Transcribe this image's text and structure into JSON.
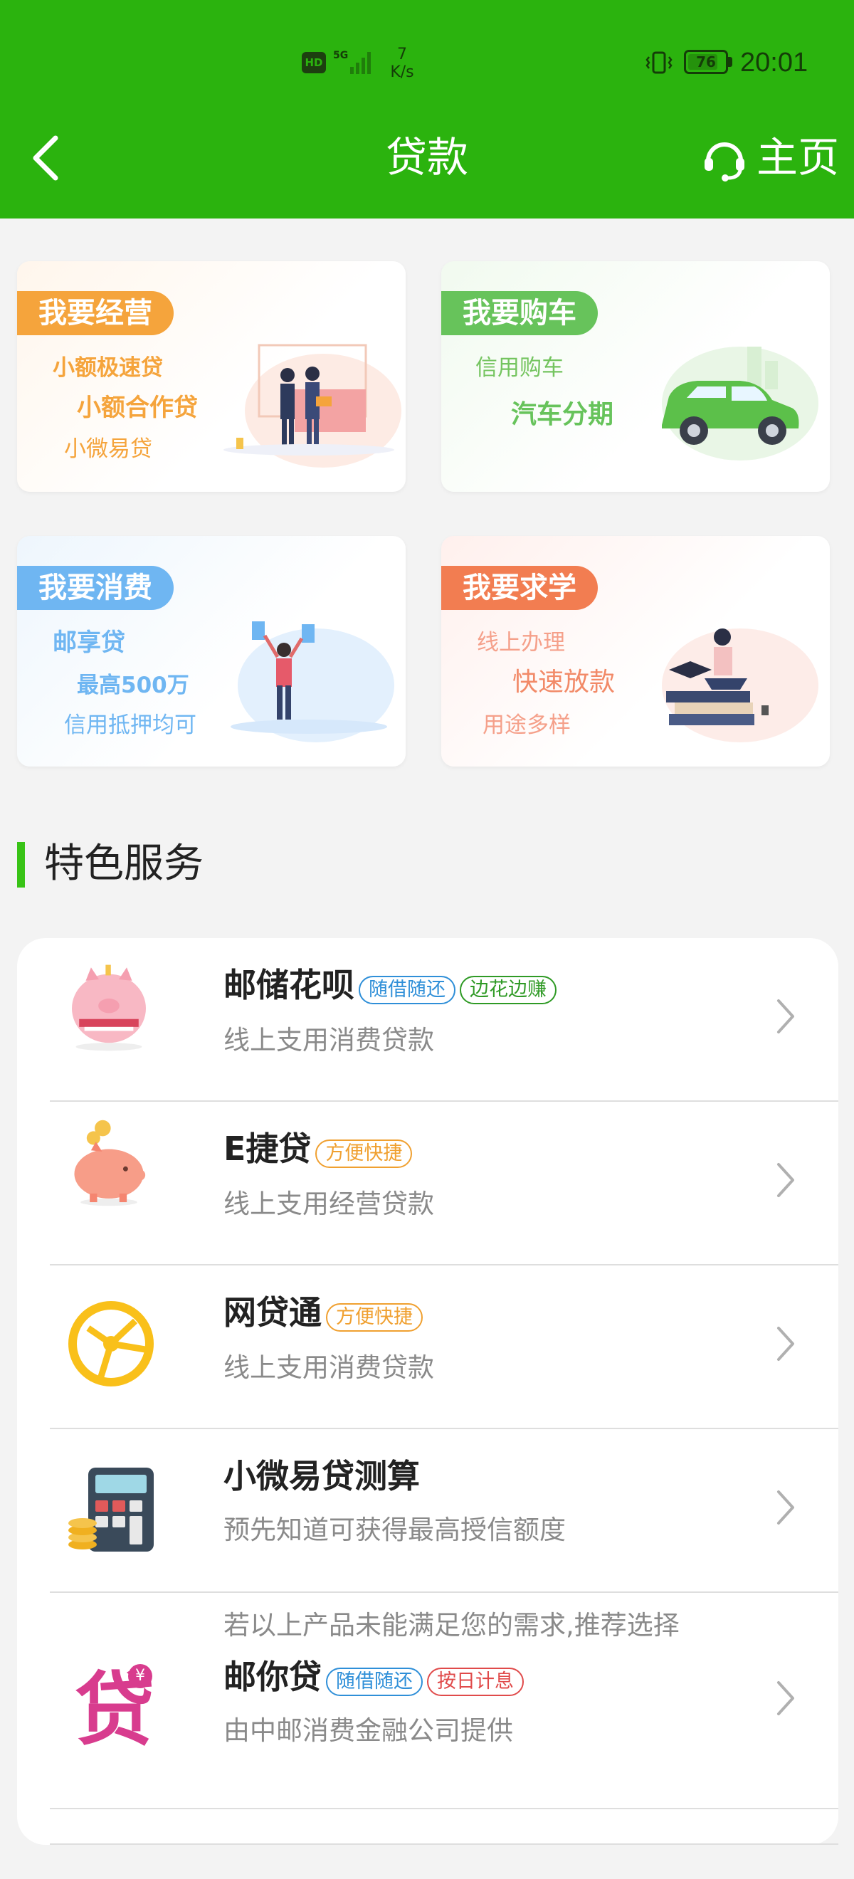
{
  "status_bar": {
    "hd": "HD",
    "net_type": "5G",
    "speed_value": "7",
    "speed_unit": "K/s",
    "battery": "76",
    "time": "20:01"
  },
  "header": {
    "title": "贷款",
    "home_label": "主页"
  },
  "categories": [
    {
      "badge": "我要经营",
      "lines": [
        "小额极速贷",
        "小额合作贷",
        "小微易贷"
      ]
    },
    {
      "badge": "我要购车",
      "lines": [
        "信用购车",
        "汽车分期"
      ]
    },
    {
      "badge": "我要消费",
      "lines": [
        "邮享贷",
        "最高500万",
        "信用抵押均可"
      ]
    },
    {
      "badge": "我要求学",
      "lines": [
        "线上办理",
        "快速放款",
        "用途多样"
      ]
    }
  ],
  "section": {
    "title": "特色服务"
  },
  "services": [
    {
      "name": "邮储花呗",
      "tags": [
        "随借随还",
        "边花边赚"
      ],
      "desc": "线上支用消费贷款"
    },
    {
      "name": "E捷贷",
      "tags": [
        "方便快捷"
      ],
      "desc": "线上支用经营贷款"
    },
    {
      "name": "网贷通",
      "tags": [
        "方便快捷"
      ],
      "desc": "线上支用消费贷款"
    },
    {
      "name": "小微易贷测算",
      "tags": [],
      "desc": "预先知道可获得最高授信额度"
    },
    {
      "name": "邮你贷",
      "tags": [
        "随借随还",
        "按日计息"
      ],
      "pre": "若以上产品未能满足您的需求,推荐选择",
      "desc": "由中邮消费金融公司提供",
      "icon_text": "贷"
    }
  ],
  "colors": {
    "header_green": "#2bb30e",
    "badge_orange": "#f5a43c",
    "badge_green": "#67c35b",
    "badge_blue": "#6fb6f2",
    "badge_red": "#f27d51",
    "tag_blue": "#2f8fd8",
    "tag_green": "#2f9a25",
    "tag_orange": "#f0a030",
    "tag_red": "#e04a4a",
    "accent_bar": "#38c316"
  }
}
